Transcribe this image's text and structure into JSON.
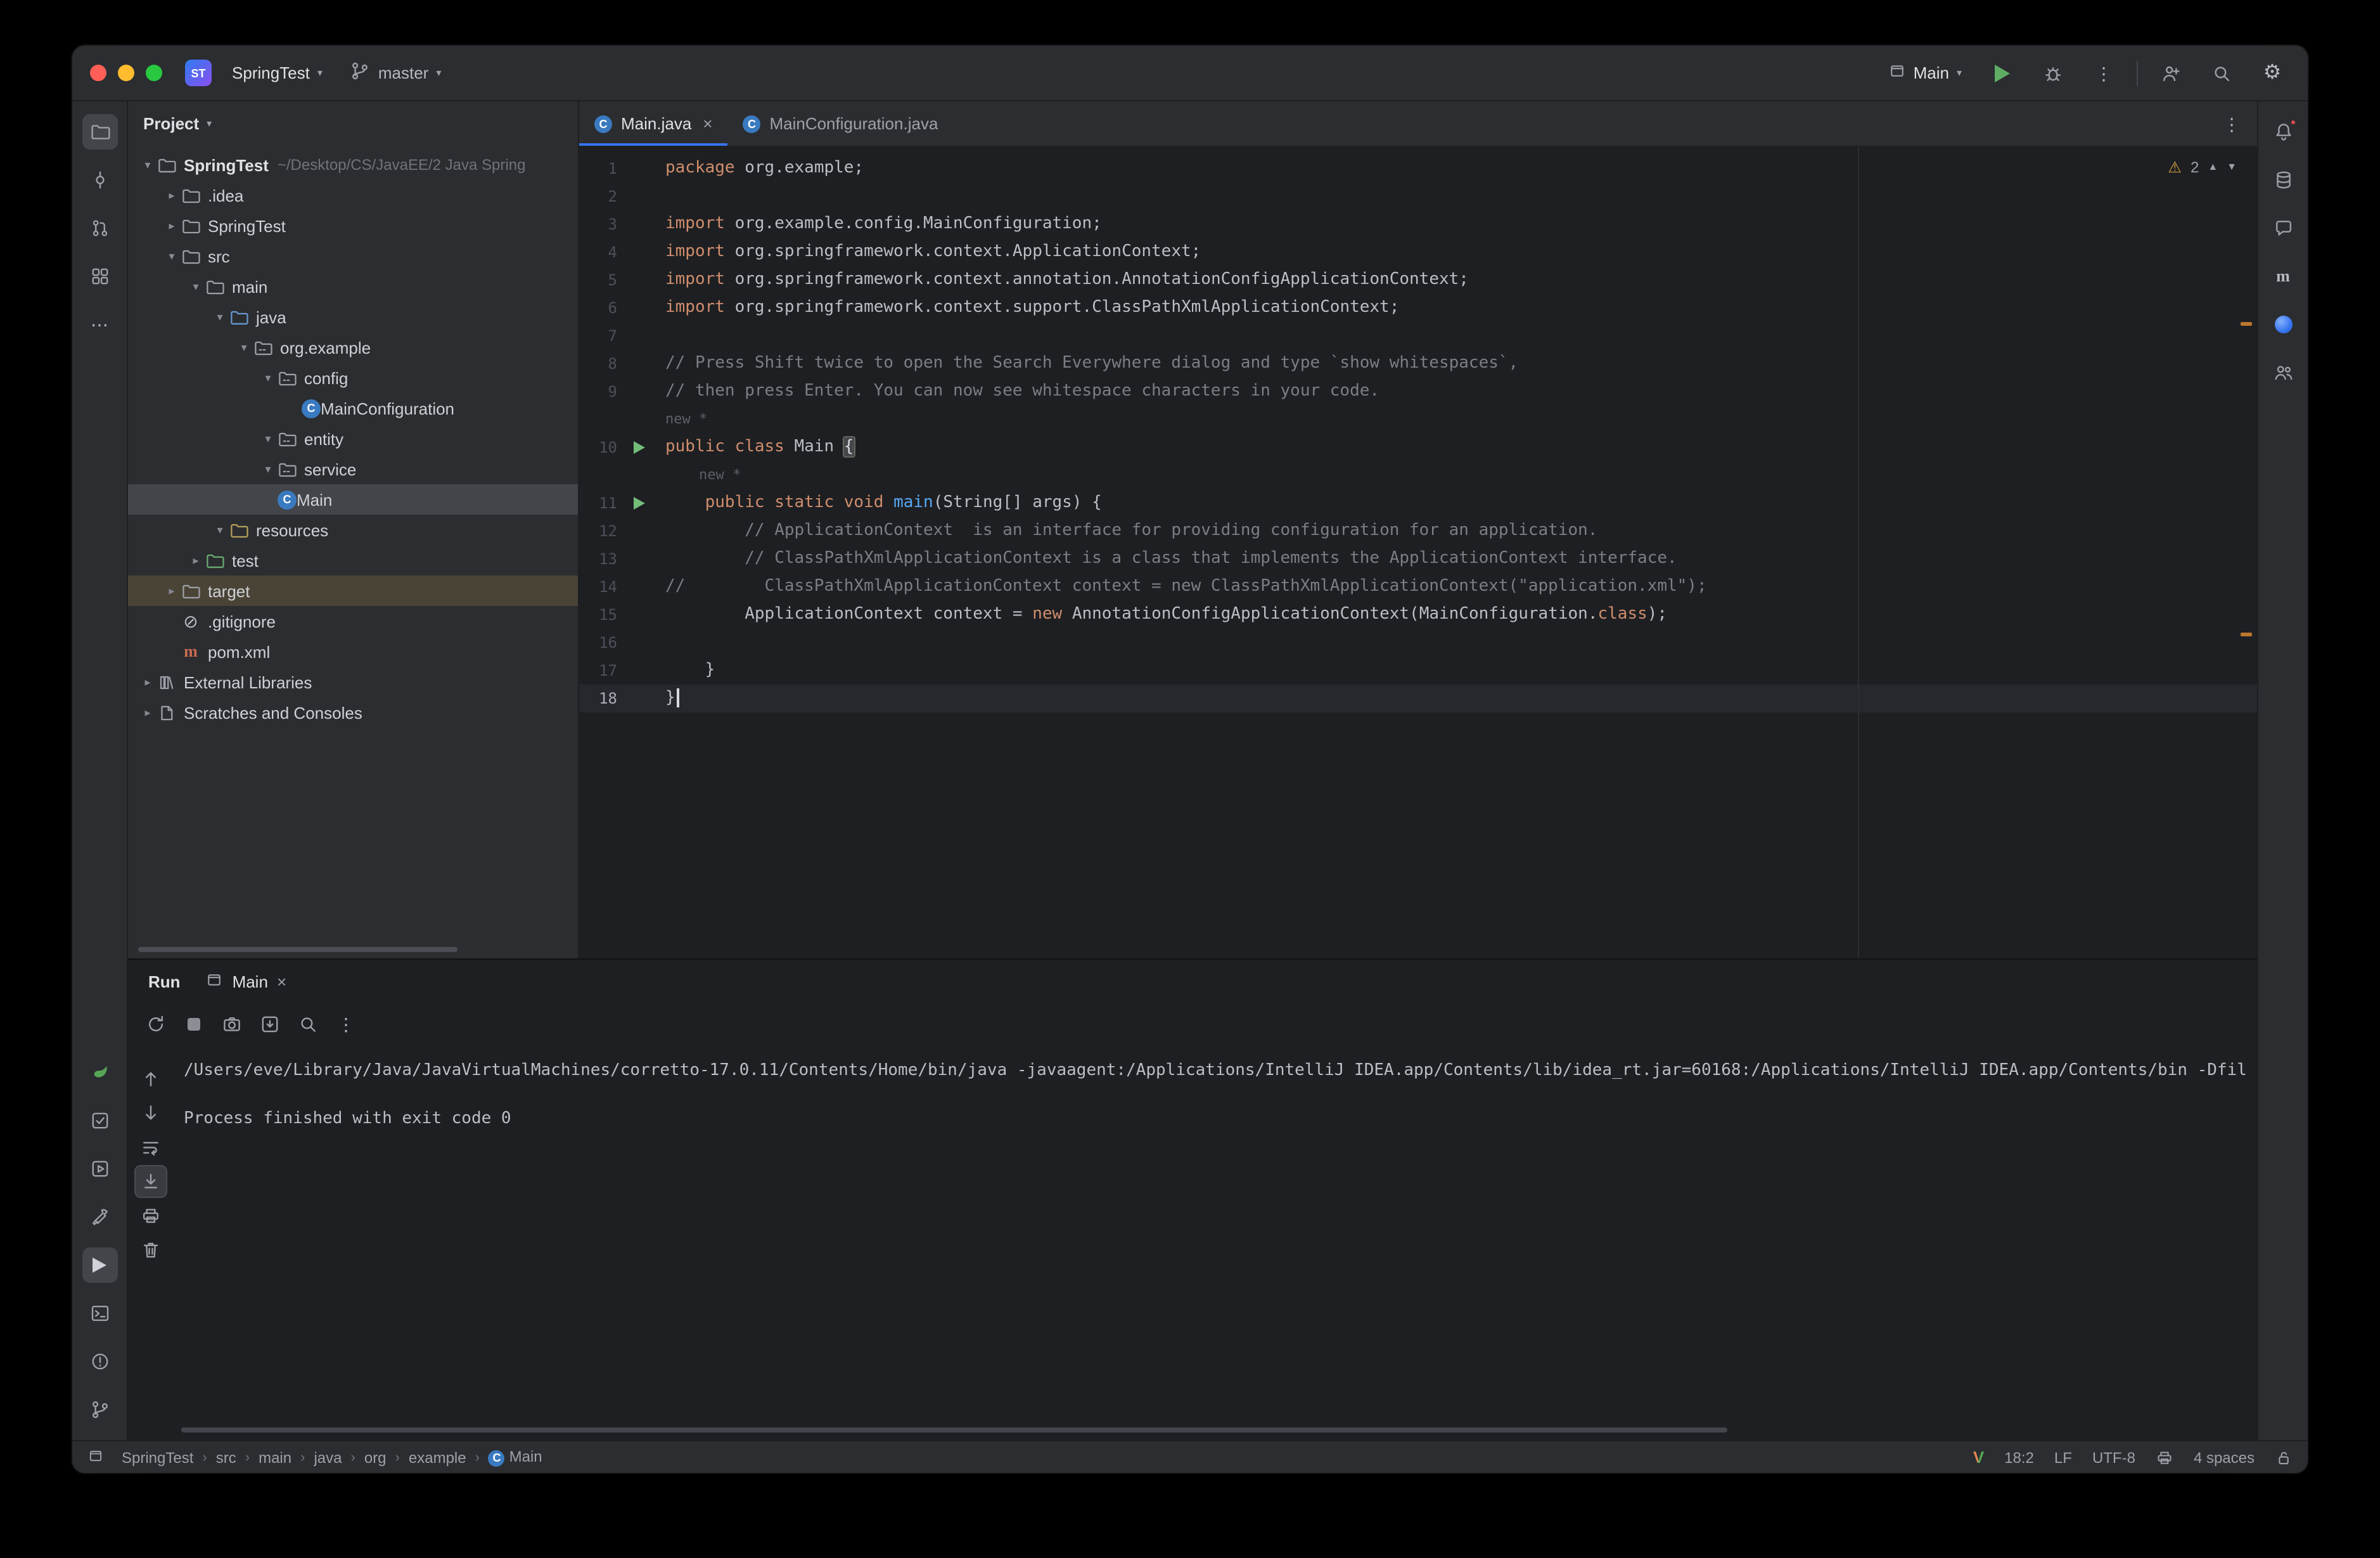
{
  "titlebar": {
    "app_badge": "ST",
    "project_name": "SpringTest",
    "branch": "master",
    "run_config": "Main"
  },
  "activity_bar": {
    "top": [
      {
        "id": "project",
        "active": true
      },
      {
        "id": "commit"
      },
      {
        "id": "pull-requests"
      },
      {
        "id": "structure"
      },
      {
        "id": "more-horizontal"
      }
    ],
    "bottom": [
      {
        "id": "spring"
      },
      {
        "id": "todo"
      },
      {
        "id": "services"
      },
      {
        "id": "build"
      },
      {
        "id": "run",
        "active": true
      },
      {
        "id": "terminal"
      },
      {
        "id": "problems"
      },
      {
        "id": "branch"
      }
    ]
  },
  "right_stripe": [
    {
      "id": "bell",
      "badge": true
    },
    {
      "id": "database"
    },
    {
      "id": "chat"
    },
    {
      "id": "maven"
    },
    {
      "id": "ai-dot"
    },
    {
      "id": "people"
    }
  ],
  "project_panel": {
    "title": "Project",
    "tree": [
      {
        "label": "SpringTest",
        "hint": "~/Desktop/CS/JavaEE/2 Java Spring",
        "level": 0,
        "chevron": "open",
        "icon": "folder",
        "bold": true
      },
      {
        "label": ".idea",
        "level": 1,
        "chevron": "closed",
        "icon": "folder"
      },
      {
        "label": "SpringTest",
        "level": 1,
        "chevron": "closed",
        "icon": "folder"
      },
      {
        "label": "src",
        "level": 1,
        "chevron": "open",
        "icon": "folder"
      },
      {
        "label": "main",
        "level": 2,
        "chevron": "open",
        "icon": "folder"
      },
      {
        "label": "java",
        "level": 3,
        "chevron": "open",
        "icon": "folder",
        "tint": "src"
      },
      {
        "label": "org.example",
        "level": 4,
        "chevron": "open",
        "icon": "package"
      },
      {
        "label": "config",
        "level": 5,
        "chevron": "open",
        "icon": "package"
      },
      {
        "label": "MainConfiguration",
        "level": 6,
        "icon": "class"
      },
      {
        "label": "entity",
        "level": 5,
        "chevron": "open",
        "icon": "package"
      },
      {
        "label": "service",
        "level": 5,
        "chevron": "open",
        "icon": "package"
      },
      {
        "label": "Main",
        "level": 5,
        "icon": "class",
        "selected": true
      },
      {
        "label": "resources",
        "level": 3,
        "chevron": "open",
        "icon": "folder",
        "tint": "res"
      },
      {
        "label": "test",
        "level": 2,
        "chevron": "closed",
        "icon": "folder",
        "tint": "test"
      },
      {
        "label": "target",
        "level": 1,
        "chevron": "closed",
        "icon": "folder",
        "excluded": true
      },
      {
        "label": ".gitignore",
        "level": 1,
        "icon": "ignored"
      },
      {
        "label": "pom.xml",
        "level": 1,
        "icon": "maven",
        "tint": "pom"
      },
      {
        "label": "External Libraries",
        "level": 0,
        "chevron": "closed",
        "icon": "lib"
      },
      {
        "label": "Scratches and Consoles",
        "level": 0,
        "chevron": "closed",
        "icon": "scratch"
      }
    ]
  },
  "editor": {
    "tabs": [
      {
        "label": "Main.java",
        "icon": "class",
        "selected": true,
        "close": true
      },
      {
        "label": "MainConfiguration.java",
        "icon": "class"
      }
    ],
    "inspections": {
      "warnings": "2"
    },
    "lines": [
      {
        "num": "1",
        "segs": [
          {
            "t": "package",
            "c": "kw"
          },
          {
            "t": " org.example;",
            "c": "def"
          }
        ]
      },
      {
        "num": "2",
        "segs": []
      },
      {
        "num": "3",
        "segs": [
          {
            "t": "import",
            "c": "kw"
          },
          {
            "t": " org.example.config.MainConfiguration;",
            "c": "def"
          }
        ]
      },
      {
        "num": "4",
        "segs": [
          {
            "t": "import",
            "c": "kw"
          },
          {
            "t": " org.springframework.context.ApplicationContext;",
            "c": "def"
          }
        ]
      },
      {
        "num": "5",
        "segs": [
          {
            "t": "import",
            "c": "kw"
          },
          {
            "t": " org.springframework.context.annotation.AnnotationConfigApplicationContext;",
            "c": "def"
          }
        ]
      },
      {
        "num": "6",
        "segs": [
          {
            "t": "import",
            "c": "kw"
          },
          {
            "t": " org.springframework.context.support.ClassPathXmlApplicationContext;",
            "c": "def"
          }
        ]
      },
      {
        "num": "7",
        "segs": []
      },
      {
        "num": "8",
        "segs": [
          {
            "t": "// Press Shift twice to open the Search Everywhere dialog and type `show whitespaces`,",
            "c": "com"
          }
        ]
      },
      {
        "num": "9",
        "segs": [
          {
            "t": "// then press Enter. You can now see whitespace characters in your code.",
            "c": "com"
          }
        ]
      },
      {
        "inlay": true,
        "segs": [
          {
            "t": "new *",
            "c": "hint"
          }
        ]
      },
      {
        "num": "10",
        "run": true,
        "segs": [
          {
            "t": "public class",
            "c": "kw"
          },
          {
            "t": " Main ",
            "c": "def"
          },
          {
            "t": "{",
            "c": "hl"
          }
        ]
      },
      {
        "inlay": true,
        "segs": [
          {
            "t": "    new *",
            "c": "hint"
          }
        ]
      },
      {
        "num": "11",
        "run": true,
        "segs": [
          {
            "t": "    ",
            "c": "def"
          },
          {
            "t": "public static void",
            "c": "kw"
          },
          {
            "t": " ",
            "c": "def"
          },
          {
            "t": "main",
            "c": "fn"
          },
          {
            "t": "(String[] args) {",
            "c": "def"
          }
        ]
      },
      {
        "num": "12",
        "segs": [
          {
            "t": "        ",
            "c": "def"
          },
          {
            "t": "// ApplicationContext  is an interface for providing configuration for an application.",
            "c": "com"
          }
        ]
      },
      {
        "num": "13",
        "segs": [
          {
            "t": "        ",
            "c": "def"
          },
          {
            "t": "// ClassPathXmlApplicationContext is a class that implements the ApplicationContext interface.",
            "c": "com"
          }
        ]
      },
      {
        "num": "14",
        "segs": [
          {
            "t": "//        ClassPathXmlApplicationContext context = new ClassPathXmlApplicationContext(\"application.xml\");",
            "c": "com"
          }
        ]
      },
      {
        "num": "15",
        "segs": [
          {
            "t": "        ApplicationContext ",
            "c": "def"
          },
          {
            "t": "context",
            "c": "var"
          },
          {
            "t": " = ",
            "c": "def"
          },
          {
            "t": "new",
            "c": "kw"
          },
          {
            "t": " AnnotationConfigApplicationContext(MainConfiguration.",
            "c": "def"
          },
          {
            "t": "class",
            "c": "kw"
          },
          {
            "t": ");",
            "c": "def"
          }
        ]
      },
      {
        "num": "16",
        "segs": []
      },
      {
        "num": "17",
        "segs": [
          {
            "t": "    }",
            "c": "def"
          }
        ]
      },
      {
        "num": "18",
        "caret": true,
        "segs": [
          {
            "t": "}",
            "c": "def"
          }
        ]
      }
    ]
  },
  "run_panel": {
    "title": "Run",
    "tab_label": "Main",
    "toolbar": [
      {
        "id": "rerun",
        "tint": "green"
      },
      {
        "id": "stop"
      },
      {
        "id": "thread-dump"
      },
      {
        "id": "heap-dump"
      },
      {
        "id": "search"
      },
      {
        "id": "more-vertical"
      }
    ],
    "side": [
      {
        "id": "up"
      },
      {
        "id": "down"
      },
      {
        "id": "soft-wrap"
      },
      {
        "id": "scroll-to-end",
        "active": true
      },
      {
        "id": "print"
      },
      {
        "id": "clear"
      }
    ],
    "console": [
      "/Users/eve/Library/Java/JavaVirtualMachines/corretto-17.0.11/Contents/Home/bin/java -javaagent:/Applications/IntelliJ IDEA.app/Contents/lib/idea_rt.jar=60168:/Applications/IntelliJ IDEA.app/Contents/bin -Dfile",
      "",
      "Process finished with exit code 0"
    ]
  },
  "status_bar": {
    "breadcrumbs": [
      "SpringTest",
      "src",
      "main",
      "java",
      "org",
      "example",
      "Main"
    ],
    "caret": "18:2",
    "line_separator": "LF",
    "encoding": "UTF-8",
    "indent": "4 spaces"
  },
  "colors": {
    "accent": "#3574f0",
    "keyword": "#cf8e6d",
    "comment": "#7a7e85",
    "method": "#56a8f5",
    "warning": "#d9a343",
    "run_green": "#5fad65",
    "editor_bg": "#1e1f22",
    "panel_bg": "#2b2d30"
  }
}
